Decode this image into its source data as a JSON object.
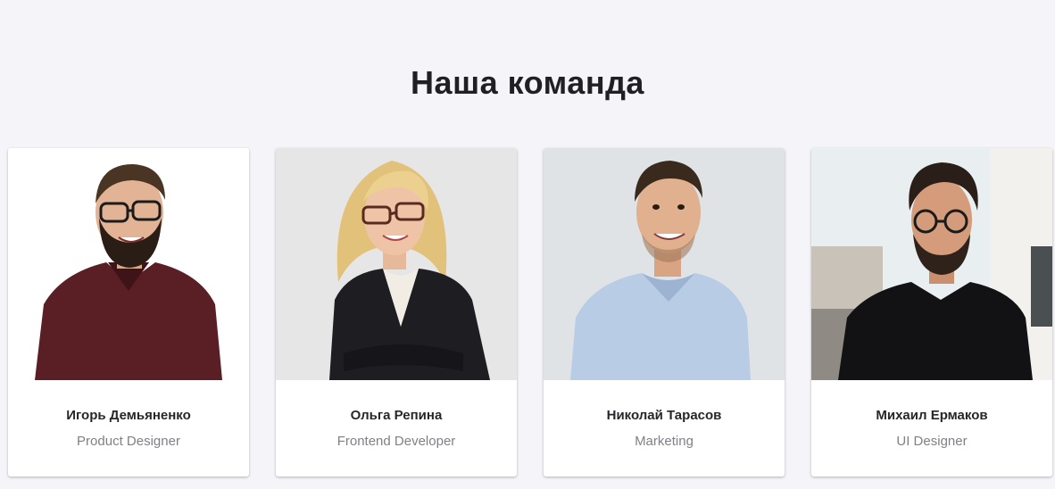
{
  "section": {
    "title": "Наша команда"
  },
  "team": [
    {
      "name": "Игорь Демьяненко",
      "role": "Product Designer",
      "photo_icon": "person-photo"
    },
    {
      "name": "Ольга Репина",
      "role": "Frontend Developer",
      "photo_icon": "person-photo"
    },
    {
      "name": "Николай Тарасов",
      "role": "Marketing",
      "photo_icon": "person-photo"
    },
    {
      "name": "Михаил Ермаков",
      "role": "UI Designer",
      "photo_icon": "person-photo"
    }
  ],
  "colors": {
    "background": "#f4f4f9",
    "card": "#ffffff",
    "title": "#1f1f24",
    "name": "#26262b",
    "role": "#808088"
  }
}
